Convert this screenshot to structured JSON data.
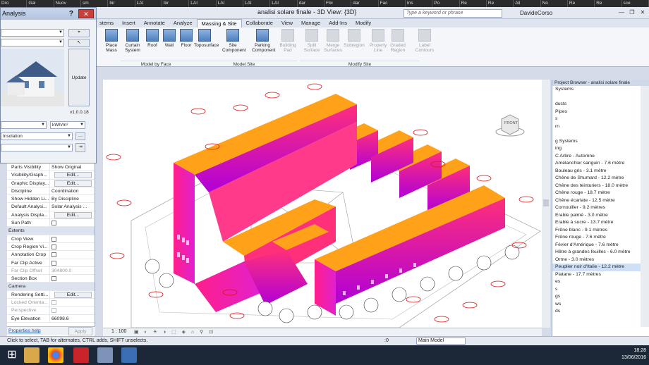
{
  "browser_tabs": [
    "Dro",
    "Gal",
    "Nuov",
    "sm",
    "bir",
    "LAI",
    "bir",
    "LAI",
    "LAI",
    "LAI",
    "LAI",
    "dar",
    "Flic",
    "dar",
    "Fac",
    "Ins",
    "Po",
    "Re",
    "Re",
    "All",
    "No",
    "Re",
    "Re",
    "sce"
  ],
  "window": {
    "title": "analisi solare finale - 3D View: {3D}",
    "search_placeholder": "Type a keyword or phrase",
    "user": "DavideCorso"
  },
  "ribbon": {
    "tabs": [
      "stems",
      "Insert",
      "Annotate",
      "Analyze",
      "Massing & Site",
      "Collaborate",
      "View",
      "Manage",
      "Add-Ins",
      "Modify"
    ],
    "active_tab": "Massing & Site",
    "buttons": [
      {
        "label": "Place Mass",
        "enabled": true
      },
      {
        "label": "Curtain System",
        "enabled": true
      },
      {
        "label": "Roof",
        "enabled": true
      },
      {
        "label": "Wall",
        "enabled": true
      },
      {
        "label": "Floor",
        "enabled": true
      },
      {
        "label": "Toposurface",
        "enabled": true
      },
      {
        "label": "Site Component",
        "enabled": true
      },
      {
        "label": "Parking Component",
        "enabled": true
      },
      {
        "label": "Building Pad",
        "enabled": false
      },
      {
        "label": "Split Surface",
        "enabled": false
      },
      {
        "label": "Merge Surfaces",
        "enabled": false
      },
      {
        "label": "Subregion",
        "enabled": false
      },
      {
        "label": "Property Line",
        "enabled": false
      },
      {
        "label": "Graded Region",
        "enabled": false
      },
      {
        "label": "Label Contours",
        "enabled": false
      }
    ],
    "panels": [
      "Model by Face",
      "Model Site",
      "Modify Site"
    ]
  },
  "dialog": {
    "title": "Analysis",
    "help": "?",
    "close": "✕",
    "update_label": "Update",
    "version": "v1.0.0.18",
    "unit": "kWh/m²",
    "result_type": "Insolation"
  },
  "properties": {
    "rows": [
      {
        "k": "Parts Visibility",
        "v": "Show Original",
        "type": "text"
      },
      {
        "k": "Visibility/Graph...",
        "v": "Edit...",
        "type": "btn"
      },
      {
        "k": "Graphic Display...",
        "v": "Edit...",
        "type": "btn"
      },
      {
        "k": "Discipline",
        "v": "Coordination",
        "type": "text"
      },
      {
        "k": "Show Hidden Li...",
        "v": "By Discipline",
        "type": "text"
      },
      {
        "k": "Default Analysi...",
        "v": "Solar Analysis ...",
        "type": "text"
      },
      {
        "k": "Analysis Displa...",
        "v": "Edit...",
        "type": "btn"
      },
      {
        "k": "Sun Path",
        "v": "",
        "type": "check"
      },
      {
        "k": "Extents",
        "v": "",
        "type": "section"
      },
      {
        "k": "Crop View",
        "v": "",
        "type": "check"
      },
      {
        "k": "Crop Region Vi...",
        "v": "",
        "type": "check"
      },
      {
        "k": "Annotation Crop",
        "v": "",
        "type": "check"
      },
      {
        "k": "Far Clip Active",
        "v": "",
        "type": "check"
      },
      {
        "k": "Far Clip Offset",
        "v": "304800.0",
        "type": "dim"
      },
      {
        "k": "Section Box",
        "v": "",
        "type": "check"
      },
      {
        "k": "Camera",
        "v": "",
        "type": "section"
      },
      {
        "k": "Rendering Setti...",
        "v": "Edit...",
        "type": "btn"
      },
      {
        "k": "Locked Orienta...",
        "v": "",
        "type": "dimcheck"
      },
      {
        "k": "Perspective",
        "v": "",
        "type": "dimcheck"
      },
      {
        "k": "Eye Elevation",
        "v": "66098.6",
        "type": "text"
      }
    ],
    "help_link": "Properties help",
    "apply": "Apply"
  },
  "viewbar": {
    "scale": "1 : 100"
  },
  "viewcube": {
    "face": "FRONT"
  },
  "project_browser": {
    "title": "Project Browser - analisi solare finale",
    "items": [
      "Systems",
      "",
      "ducts",
      "Pipes",
      "s",
      "rn",
      "",
      "g Systems",
      "ing",
      "C Arbre - Automne",
      "Amélanchier sanguin - 7.6 mètre",
      "Bouleau gris - 3.1 mètre",
      "Chêne de Shumard - 12.2 mètre",
      "Chêne des teinturiers - 18.0 mètre",
      "Chêne rouge - 18.7 mètre",
      "Chêne écarlate - 12.5 mètre",
      "Cornouiller - 9.2 mètres",
      "Erable palmé - 3.0 mètre",
      "Erable à sucre - 13.7 mètre",
      "Frêne blanc - 9.1 mètres",
      "Frêne rouge - 7.6 mètre",
      "Févier d'Amérique - 7.6 mètre",
      "Hêtre à grandes feuilles - 6.0 mètre",
      "Orme - 3.0 mètres",
      "Peuplier noir d'Italie - 12.2 mètre",
      "Platane - 17.7 mètres",
      "es",
      "s",
      "gs",
      "ws",
      "ds"
    ],
    "highlighted": "Peuplier noir d'Italie - 12.2 mètre"
  },
  "statusbar": {
    "hint": "Click to select, TAB for alternates, CTRL adds, SHIFT unselects.",
    "model": "Main Model",
    "zero": ":0"
  },
  "taskbar": {
    "time": "18:28",
    "date": "13/06/2016"
  }
}
